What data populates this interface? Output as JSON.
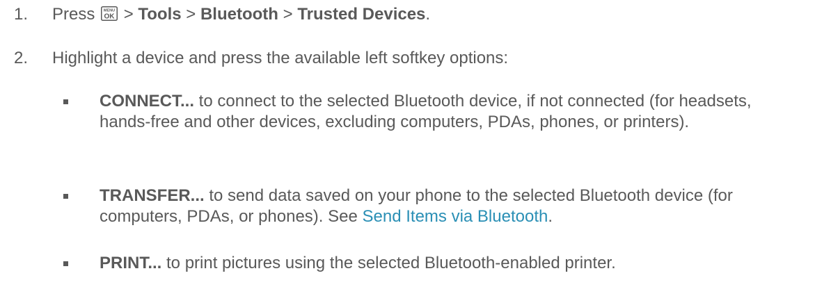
{
  "steps": [
    {
      "number": "1.",
      "prefix": "Press",
      "key_icon_top": "MENU",
      "key_icon_bottom": "OK",
      "sep1": " > ",
      "item1": "Tools",
      "sep2": " > ",
      "item2": "Bluetooth",
      "sep3": " > ",
      "item3": "Trusted Devices",
      "end": "."
    },
    {
      "number": "2.",
      "text": "Highlight a device and press the available left softkey options:"
    }
  ],
  "bullets": [
    {
      "term": "CONNECT...",
      "text": " to connect to the selected Bluetooth device, if not connected (for headsets, hands-free and other devices, excluding computers, PDAs, phones, or printers)."
    },
    {
      "term": "TRANSFER...",
      "text": " to send data saved on your phone to the selected Bluetooth device (for computers, PDAs, or phones). See ",
      "link": "Send Items via Bluetooth",
      "end": "."
    },
    {
      "term": "PRINT...",
      "text": " to print pictures using the selected Bluetooth-enabled printer."
    }
  ],
  "colors": {
    "text": "#595959",
    "link": "#2a8fb5"
  }
}
